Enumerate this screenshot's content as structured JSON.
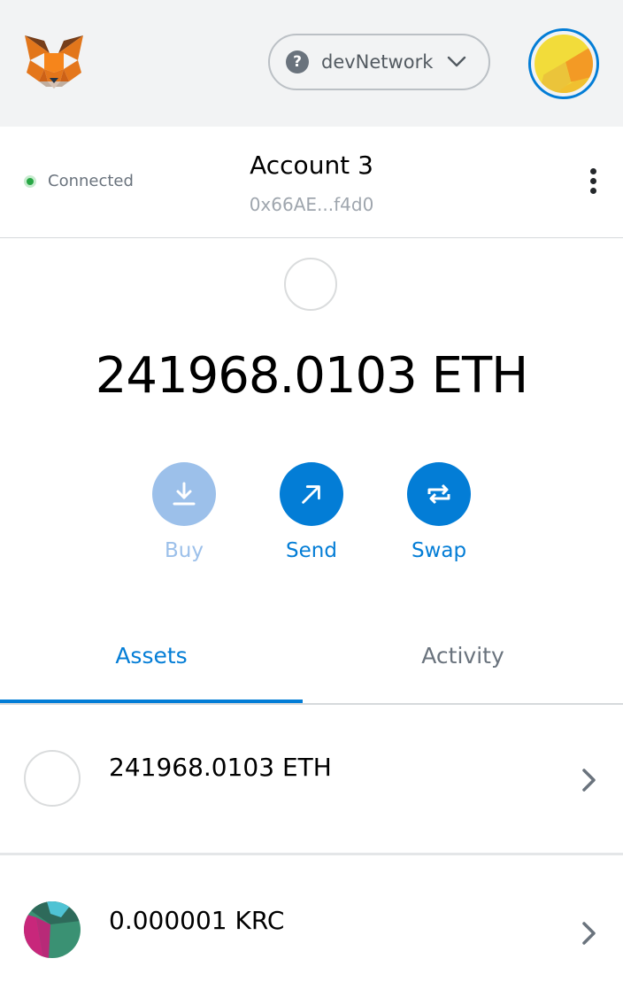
{
  "header": {
    "logo_icon": "metamask-fox-icon",
    "network": {
      "icon": "question-mark-icon",
      "name": "devNetwork",
      "dropdown_icon": "chevron-down-icon"
    },
    "avatar_icon": "account-identicon"
  },
  "account": {
    "status_label": "Connected",
    "status_color": "#28a745",
    "name": "Account 3",
    "address": "0x66AE...f4d0",
    "menu_icon": "kebab-menu-icon"
  },
  "balance": {
    "amount_text": "241968.0103 ETH"
  },
  "actions": {
    "buy": {
      "label": "Buy",
      "icon": "download-icon"
    },
    "send": {
      "label": "Send",
      "icon": "arrow-up-right-icon"
    },
    "swap": {
      "label": "Swap",
      "icon": "swap-arrows-icon"
    }
  },
  "tabs": {
    "assets": "Assets",
    "activity": "Activity"
  },
  "assets": [
    {
      "amount": "241968.0103 ETH"
    },
    {
      "amount": "0.000001 KRC"
    }
  ],
  "colors": {
    "accent": "#037dd6",
    "accent_disabled": "#9cc0ea",
    "header_bg": "#f2f3f4"
  }
}
